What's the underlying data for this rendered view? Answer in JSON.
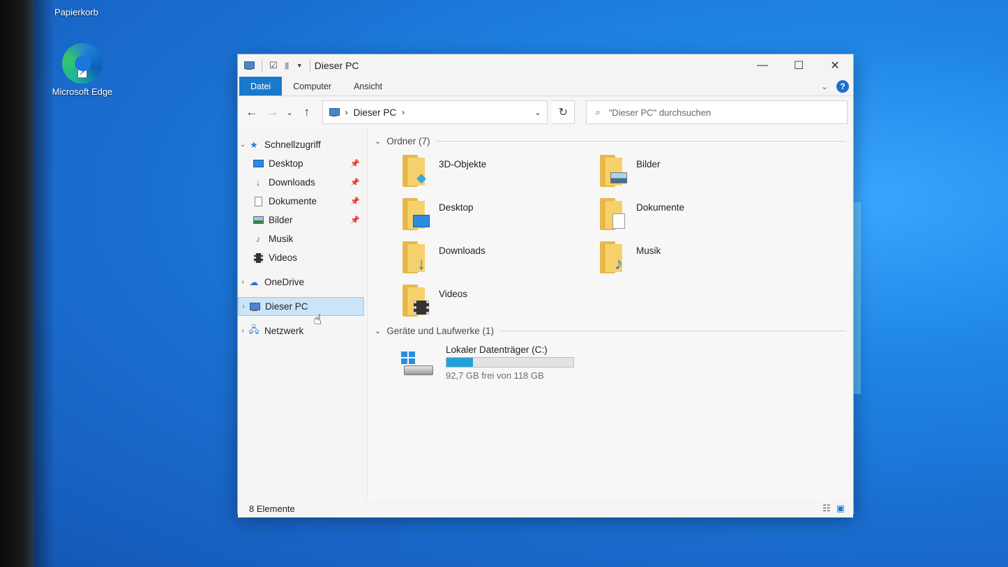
{
  "desktop": {
    "recycle_label": "Papierkorb",
    "edge_label": "Microsoft Edge"
  },
  "window": {
    "title": "Dieser PC",
    "ribbon_tabs": [
      "Datei",
      "Computer",
      "Ansicht"
    ],
    "address_path": "Dieser PC",
    "search_placeholder": "\"Dieser PC\" durchsuchen"
  },
  "sidebar": {
    "quick_access": "Schnellzugriff",
    "quick_items": [
      {
        "label": "Desktop",
        "icon": "desktop-icon"
      },
      {
        "label": "Downloads",
        "icon": "download-arrow-icon"
      },
      {
        "label": "Dokumente",
        "icon": "document-icon"
      },
      {
        "label": "Bilder",
        "icon": "picture-icon"
      },
      {
        "label": "Musik",
        "icon": "music-note-icon"
      },
      {
        "label": "Videos",
        "icon": "film-icon"
      }
    ],
    "onedrive": "OneDrive",
    "this_pc": "Dieser PC",
    "network": "Netzwerk"
  },
  "content": {
    "folders_header": "Ordner (7)",
    "folders": [
      "3D-Objekte",
      "Bilder",
      "Desktop",
      "Dokumente",
      "Downloads",
      "Musik",
      "Videos"
    ],
    "drives_header": "Geräte und Laufwerke (1)",
    "drive": {
      "name": "Lokaler Datenträger (C:)",
      "free_text": "92,7 GB frei von 118 GB",
      "used_fraction": 0.21
    }
  },
  "status": {
    "items": "8 Elemente"
  },
  "colors": {
    "accent": "#1979ca",
    "selection": "#cce4f7",
    "drive_fill": "#26a0da"
  }
}
